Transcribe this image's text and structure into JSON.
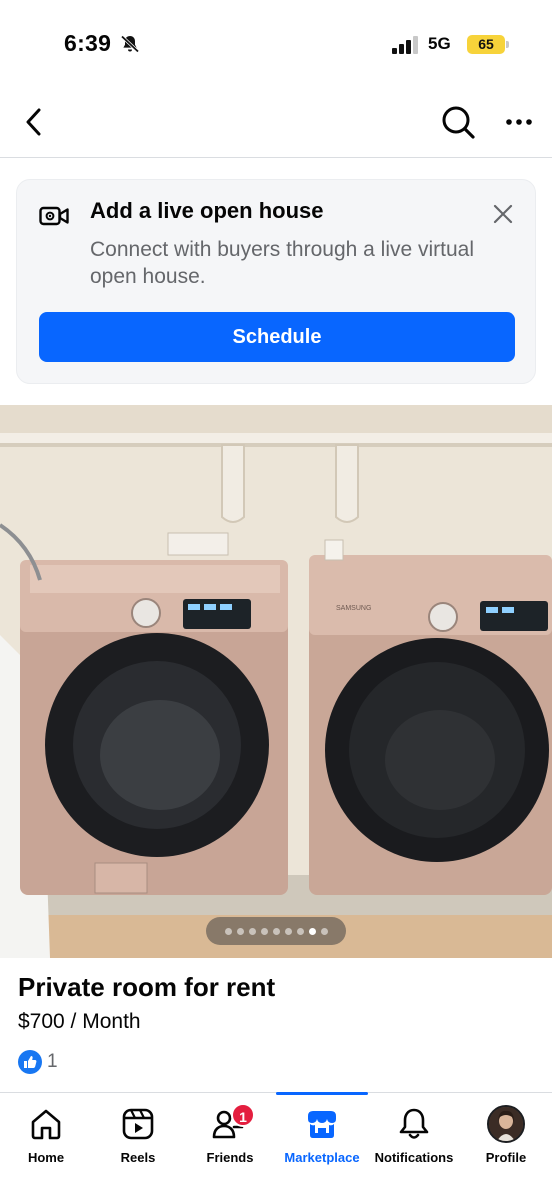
{
  "status_bar": {
    "time": "6:39",
    "network": "5G",
    "battery": "65"
  },
  "nav": {
    "back_icon": "chevron-left-icon",
    "search_icon": "search-icon",
    "more_icon": "more-horizontal-icon"
  },
  "open_house_card": {
    "title": "Add a live open house",
    "description": "Connect with buyers through a live virtual open house.",
    "button_label": "Schedule",
    "icon": "live-video-icon",
    "close_icon": "close-icon"
  },
  "photo": {
    "image_count": 9,
    "active_index": 7,
    "logos": [
      "SAMSUNG"
    ]
  },
  "listing": {
    "title": "Private room for rent",
    "price": "$700 / Month",
    "likes": "1"
  },
  "tabs": [
    {
      "label": "Home",
      "icon": "home-icon"
    },
    {
      "label": "Reels",
      "icon": "reels-icon"
    },
    {
      "label": "Friends",
      "icon": "friends-icon",
      "badge": "1"
    },
    {
      "label": "Marketplace",
      "icon": "marketplace-icon",
      "active": true
    },
    {
      "label": "Notifications",
      "icon": "bell-icon"
    },
    {
      "label": "Profile",
      "icon": "avatar"
    }
  ],
  "colors": {
    "accent": "#0866ff",
    "badge": "#e41e3f",
    "battery": "#f7d33a",
    "secondary_text": "#65676b"
  }
}
